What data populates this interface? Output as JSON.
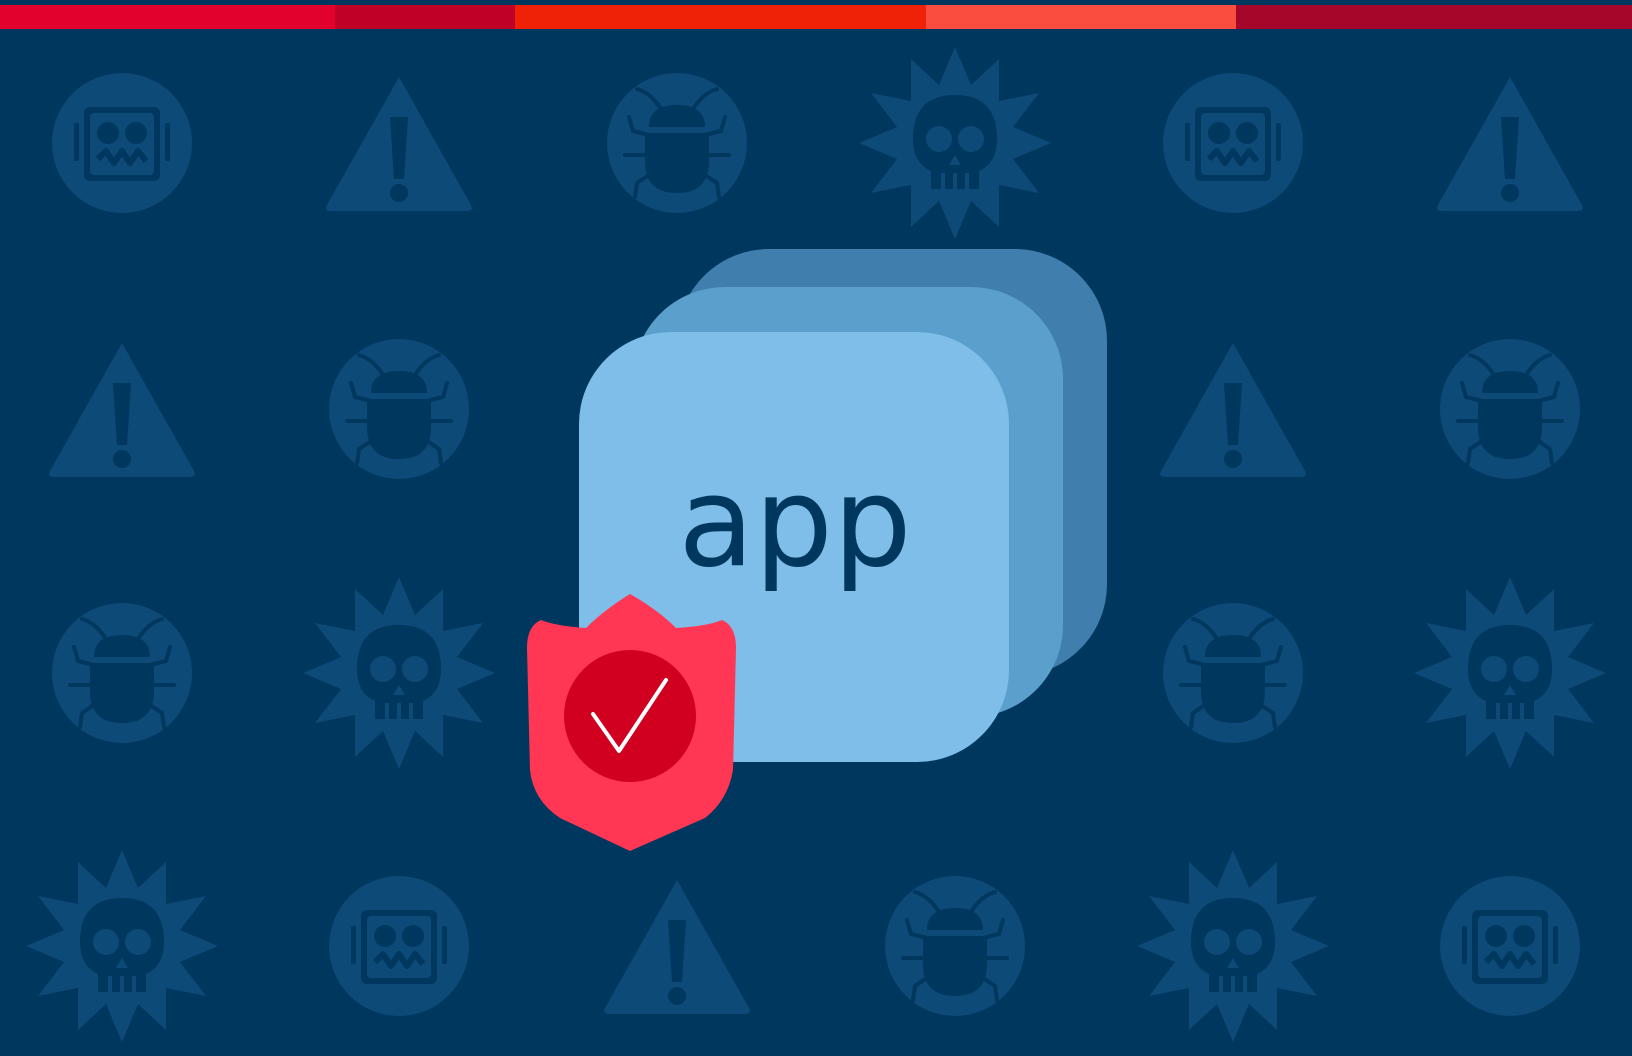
{
  "app_stack": {
    "label": "app"
  },
  "colors": {
    "background": "#00375F",
    "pattern_icon": "#0D4A78",
    "card_front": "#7EBEE8",
    "card_middle": "#5B9FCC",
    "card_back": "#407FAD",
    "label_text": "#00375F",
    "shield_outer": "#FF3754",
    "shield_inner": "#D10020",
    "checkmark": "#FFFFFF"
  },
  "top_stripe": {
    "segments": [
      {
        "color": "#E2002D",
        "width_fraction": 0.205
      },
      {
        "color": "#C00026",
        "width_fraction": 0.11
      },
      {
        "color": "#EF2106",
        "width_fraction": 0.252
      },
      {
        "color": "#FA4D40",
        "width_fraction": 0.19
      },
      {
        "color": "#A5072A",
        "width_fraction": 0.243
      }
    ]
  },
  "background_pattern": {
    "rows": [
      [
        "robot-icon",
        "warning-icon",
        "bug-icon",
        "skull-sun-icon",
        "robot-icon",
        "warning-icon"
      ],
      [
        "warning-icon",
        "bug-icon",
        null,
        null,
        "warning-icon",
        "bug-icon"
      ],
      [
        "bug-icon",
        "skull-sun-icon",
        null,
        null,
        "bug-icon",
        "skull-sun-icon"
      ],
      [
        "skull-sun-icon",
        "robot-icon",
        "warning-icon",
        "bug-icon",
        "skull-sun-icon",
        "robot-icon"
      ]
    ]
  },
  "shield": {
    "icon": "shield-check-icon"
  }
}
